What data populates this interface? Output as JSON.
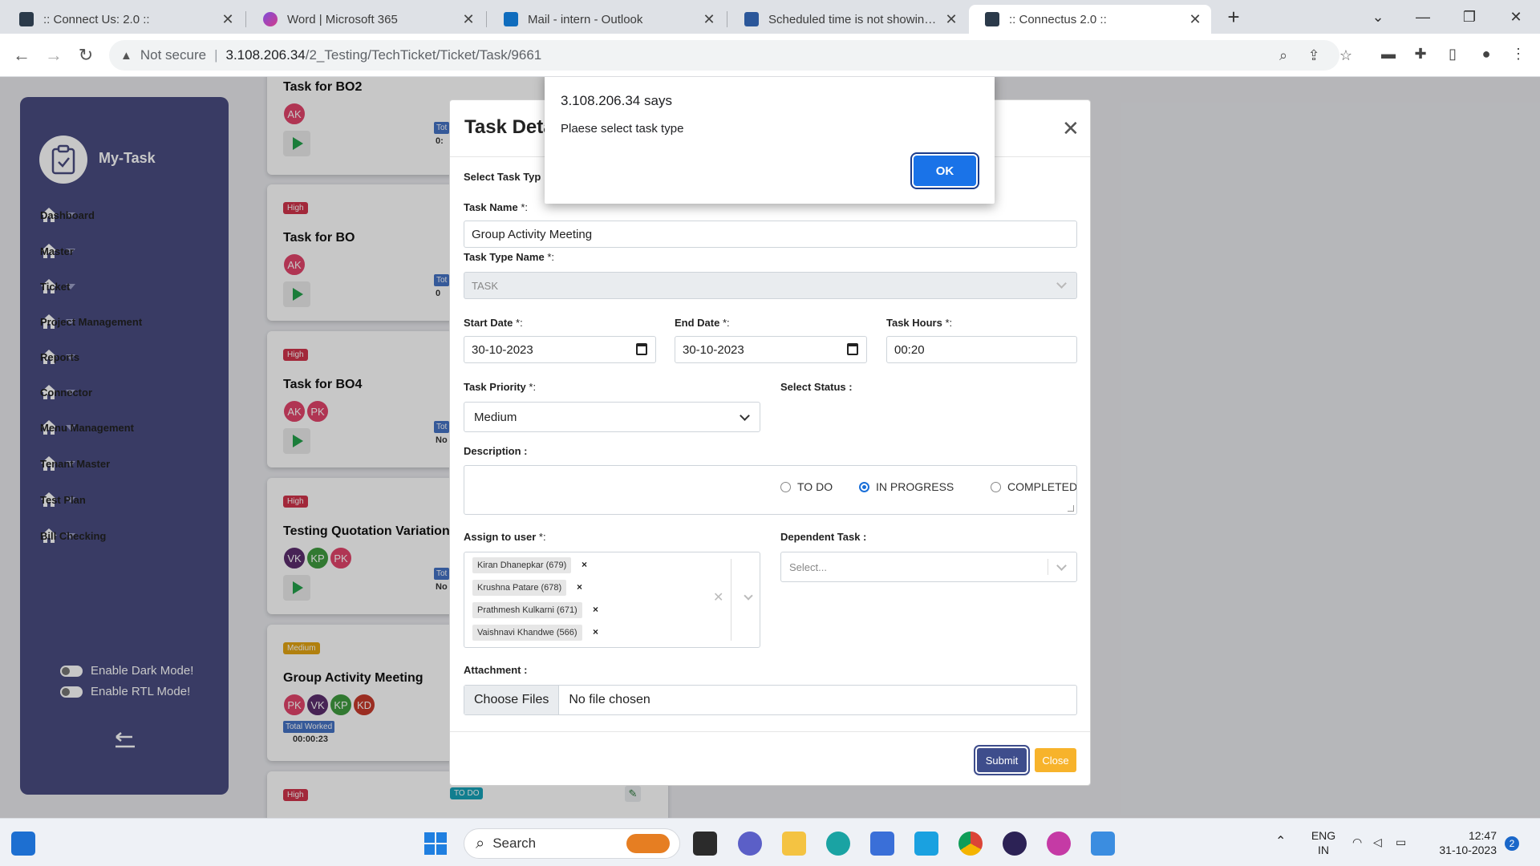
{
  "browser": {
    "tabs": [
      {
        "title": ":: Connect Us: 2.0 ::",
        "active": false
      },
      {
        "title": "Word | Microsoft 365",
        "active": false
      },
      {
        "title": "Mail - intern - Outlook",
        "active": false
      },
      {
        "title": "Scheduled time is not showing i",
        "active": false
      },
      {
        "title": ":: Connectus 2.0 ::",
        "active": true
      }
    ],
    "not_secure": "Not secure",
    "url_host": "3.108.206.34",
    "url_path": "/2_Testing/TechTicket/Ticket/Task/9661"
  },
  "sidebar": {
    "app_name": "My-Task",
    "items": [
      {
        "label": "Dashboard"
      },
      {
        "label": "Master"
      },
      {
        "label": "Ticket"
      },
      {
        "label": "Project Management"
      },
      {
        "label": "Reports"
      },
      {
        "label": "Connector"
      },
      {
        "label": "Menu Management"
      },
      {
        "label": "Tenant Master"
      },
      {
        "label": "Test Plan"
      },
      {
        "label": "Bill Checking"
      }
    ],
    "dark_mode_label": "Enable Dark Mode!",
    "rtl_mode_label": "Enable RTL Mode!"
  },
  "cards": [
    {
      "priority": "",
      "title": "Task for BO2",
      "avatars": [
        "AK"
      ],
      "total_chip": "Tot",
      "total_val": "0:"
    },
    {
      "priority": "High",
      "title": "Task for BO",
      "avatars": [
        "AK"
      ],
      "total_chip": "Tot",
      "total_val": "0"
    },
    {
      "priority": "High",
      "title": "Task for BO4",
      "avatars": [
        "AK",
        "PK"
      ],
      "total_chip": "Tot",
      "total_val": "No"
    },
    {
      "priority": "High",
      "title": "Testing Quotation Variation",
      "avatars": [
        "VK",
        "KP",
        "PK"
      ],
      "total_chip": "Tot",
      "total_val": "No"
    },
    {
      "priority": "Medium",
      "title": "Group Activity Meeting",
      "avatars": [
        "PK",
        "VK",
        "KP",
        "KD"
      ],
      "total_chip": "Total Worked",
      "total_val": "00:00:23"
    },
    {
      "priority": "High",
      "status": "TO DO"
    }
  ],
  "modal": {
    "title": "Task Deta",
    "select_task_type_label": "Select Task Typ",
    "task_name_label": "Task Name",
    "task_name_value": "Group Activity Meeting",
    "task_type_name_label": "Task Type Name",
    "task_type_name_value": "TASK",
    "start_date_label": "Start Date",
    "start_date_value": "30-10-2023",
    "end_date_label": "End Date",
    "end_date_value": "30-10-2023",
    "task_hours_label": "Task Hours",
    "task_hours_value": "00:20",
    "task_priority_label": "Task Priority",
    "task_priority_value": "Medium",
    "select_status_label": "Select Status :",
    "status_options": [
      "TO DO",
      "IN PROGRESS",
      "COMPLETED"
    ],
    "status_selected": "IN PROGRESS",
    "description_label": "Description :",
    "assign_label": "Assign to user",
    "assigned_users": [
      "Kiran Dhanepkar (679)",
      "Krushna Patare (678)",
      "Prathmesh Kulkarni (671)",
      "Vaishnavi Khandwe (566)"
    ],
    "dependent_label": "Dependent Task :",
    "dependent_placeholder": "Select...",
    "attachment_label": "Attachment :",
    "choose_files": "Choose Files",
    "no_file": "No file chosen",
    "submit": "Submit",
    "close": "Close",
    "required_mark": "*:"
  },
  "alert": {
    "title": "3.108.206.34 says",
    "message": "Plaese select task type",
    "ok": "OK"
  },
  "taskbar": {
    "search": "Search",
    "lang_top": "ENG",
    "lang_bottom": "IN",
    "time": "12:47",
    "date": "31-10-2023",
    "notif_count": "2"
  },
  "colors": {
    "sidebar": "#494c80",
    "high": "#d0344b",
    "medium": "#e3a512",
    "submit": "#3e4d8c",
    "close": "#f7b32b",
    "ok": "#1a73e8"
  }
}
